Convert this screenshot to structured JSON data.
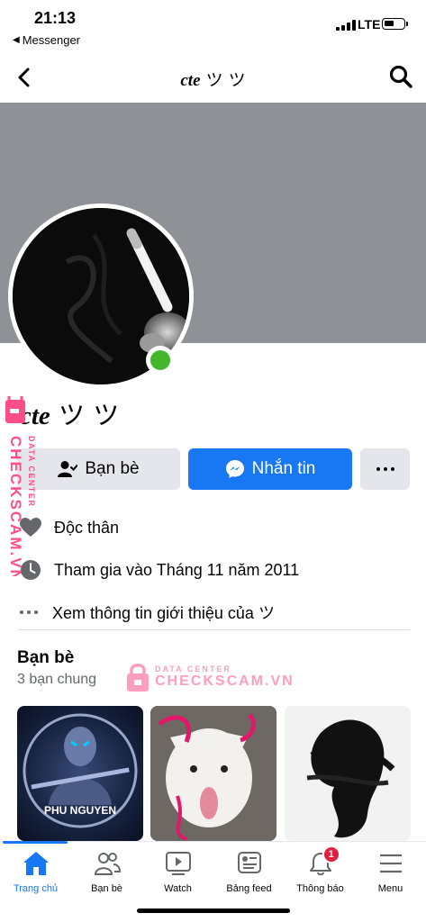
{
  "status_bar": {
    "time": "21:13",
    "back_app": "Messenger",
    "network": "LTE"
  },
  "header": {
    "title_prefix": "cte",
    "title_suffix": "ツ ツ"
  },
  "profile": {
    "name_prefix": "cte",
    "name_suffix": "ツ ツ",
    "online": true,
    "online_color": "#42b72a"
  },
  "actions": {
    "friends_label": "Bạn bè",
    "message_label": "Nhắn tin",
    "accent": "#1877f2"
  },
  "info": {
    "relationship": "Độc thân",
    "joined": "Tham gia vào Tháng 11 năm 2011",
    "about_link": "Xem thông tin giới thiệu của ツ"
  },
  "friends": {
    "title": "Bạn bè",
    "mutual": "3 bạn chung",
    "cards": [
      {
        "caption": "PHU NGUYEN"
      },
      {
        "caption": ""
      },
      {
        "caption": ""
      }
    ]
  },
  "watermark": {
    "small": "DATA CENTER",
    "big": "CHECKSCAM.VN",
    "side_small": "DATA CENTER",
    "side_big": "CHECKSCAM.VN"
  },
  "tabs": [
    {
      "label": "Trang chủ",
      "icon": "home-icon",
      "active": true
    },
    {
      "label": "Bạn bè",
      "icon": "friends-icon"
    },
    {
      "label": "Watch",
      "icon": "watch-icon"
    },
    {
      "label": "Bảng feed",
      "icon": "feed-icon"
    },
    {
      "label": "Thông báo",
      "icon": "bell-icon",
      "badge": "1"
    },
    {
      "label": "Menu",
      "icon": "menu-icon"
    }
  ]
}
